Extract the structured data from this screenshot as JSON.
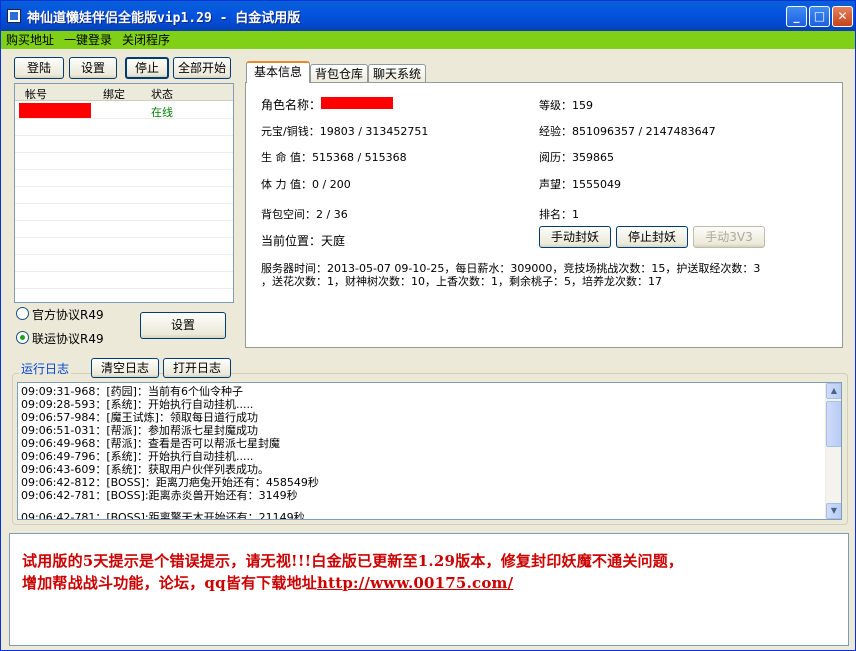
{
  "window": {
    "title": "神仙道懒娃伴侣全能版vip1.29 - 白金试用版"
  },
  "menu": [
    "购买地址",
    "一键登录",
    "关闭程序"
  ],
  "toolbar": {
    "login": "登陆",
    "settings": "设置",
    "stop": "停止",
    "start_all": "全部开始"
  },
  "accounts": {
    "headers": [
      "帐号",
      "绑定",
      "状态"
    ],
    "rows": [
      {
        "bind": "",
        "status": "在线"
      }
    ]
  },
  "protocol": {
    "official": "官方协议R49",
    "joint": "联运协议R49",
    "selected": "joint",
    "settings": "设置"
  },
  "tabs": [
    "基本信息",
    "背包仓库",
    "聊天系统"
  ],
  "info": {
    "name_label": "角色名称：",
    "level": "等级：159",
    "gold": "元宝/铜钱：19803 / 313452751",
    "exp": "经验：851096357 / 2147483647",
    "hp": "生 命 值：515368 / 515368",
    "exp2": "阅历：359865",
    "stamina": "体 力 值：0 / 200",
    "fame": "声望：1555049",
    "bag": "背包空间：2 / 36",
    "rank": "排名：1",
    "location": "当前位置：天庭",
    "btn_seal": "手动封妖",
    "btn_stop_seal": "停止封妖",
    "btn_3v3": "手动3V3",
    "server_line1": "服务器时间：2013-05-07 09-10-25，每日薪水：309000，竞技场挑战次数：15，护送取经次数：3",
    "server_line2": "，送花次数：1，财神树次数：10，上香次数：1，剩余桃子：5，培养龙次数：17"
  },
  "log": {
    "label": "运行日志",
    "clear": "清空日志",
    "open": "打开日志",
    "lines": [
      "09:09:31-968：[药园]：当前有6个仙令种子",
      "09:09:28-593：[系统]：开始执行自动挂机.....",
      "09:06:57-984：[魔王试炼]：领取每日道行成功",
      "09:06:51-031：[帮派]：参加帮派七星封魔成功",
      "09:06:49-968：[帮派]：查看是否可以帮派七星封魔",
      "09:06:49-796：[系统]：开始执行自动挂机.....",
      "09:06:43-609：[系统]：获取用户伙伴列表成功。",
      "09:06:42-812：[BOSS]：距离刀疤兔开始还有：458549秒",
      "09:06:42-781：[BOSS]:距离赤炎兽开始还有：3149秒",
      "09:06:42-781：[BOSS]:距离擎天木开始还有：21149秒"
    ]
  },
  "notice": {
    "line1": "试用版的5天提示是个错误提示，请无视!!!白金版已更新至1.29版本，修复封印妖魔不通关问题，",
    "line2_prefix": "增加帮战战斗功能，论坛，qq皆有下载地址",
    "line2_link": "http://www.00175.com/"
  }
}
